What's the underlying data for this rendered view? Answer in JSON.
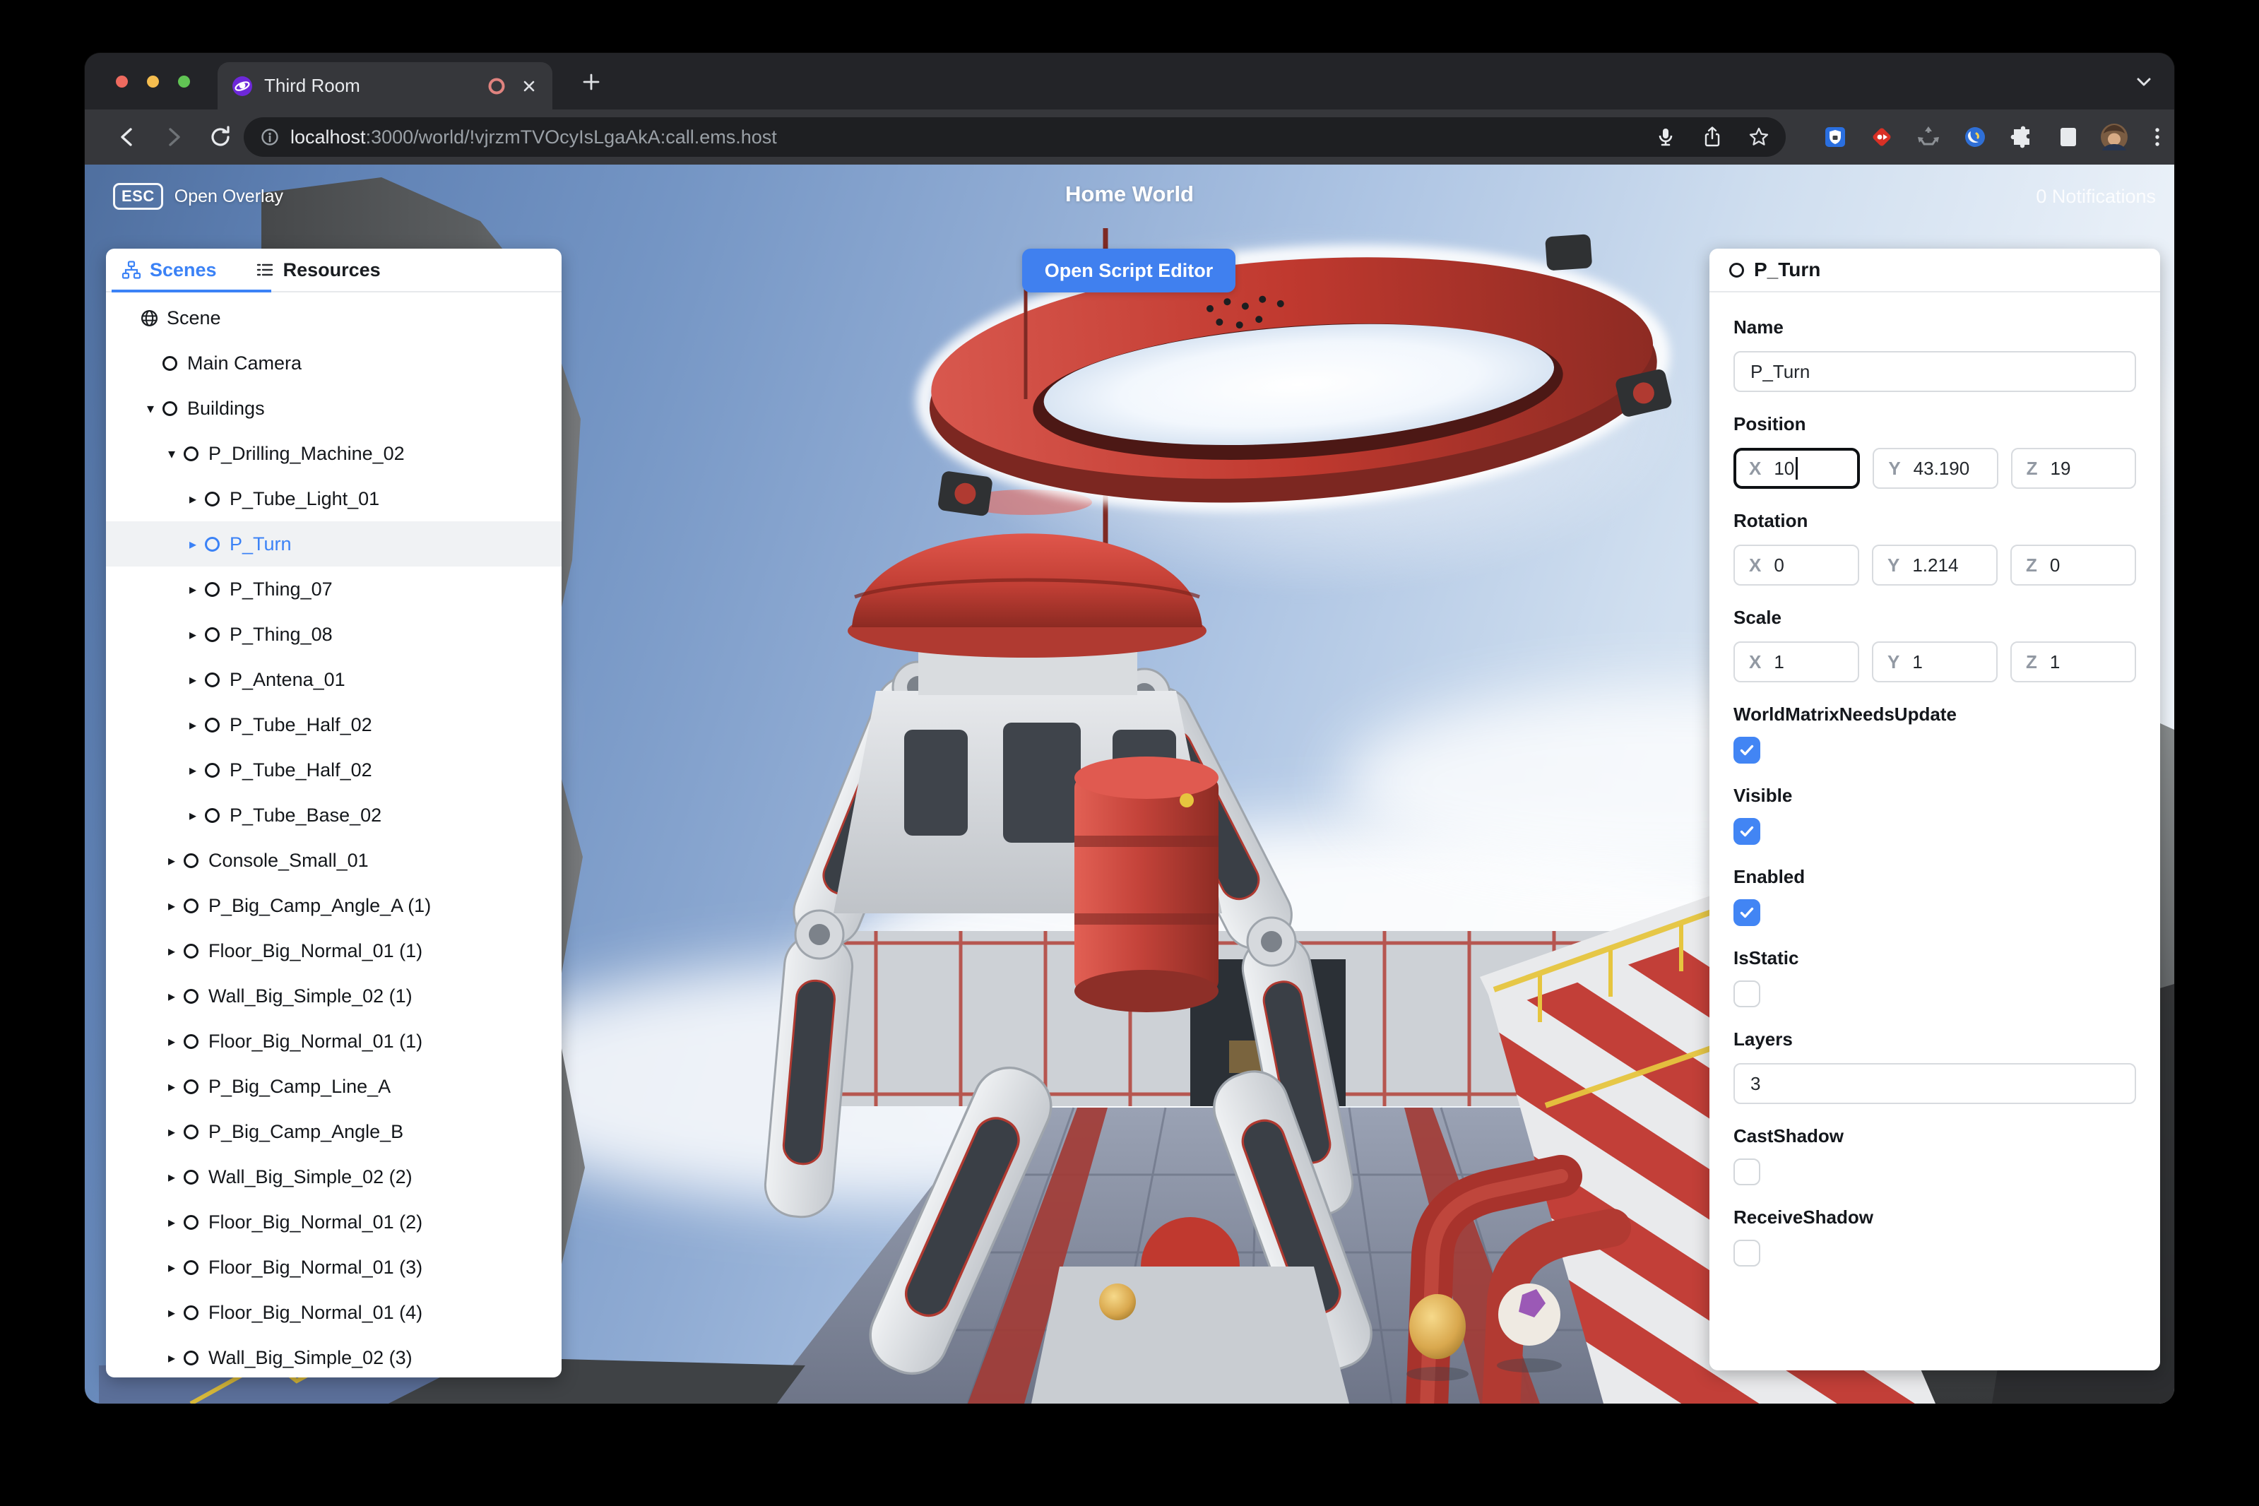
{
  "browser": {
    "tab_title": "Third Room",
    "new_tab": "+",
    "url_host": "localhost",
    "url_path": ":3000/world/!vjrzmTVOcyIsLgaAkA:call.ems.host"
  },
  "hud": {
    "esc_key": "ESC",
    "esc_label": "Open Overlay",
    "title": "Home World",
    "notifications": "0 Notifications",
    "script_editor": "Open Script Editor"
  },
  "left_panel": {
    "tabs": [
      {
        "label": "Scenes",
        "active": true
      },
      {
        "label": "Resources",
        "active": false
      }
    ],
    "tree": [
      {
        "label": "Scene",
        "depth": 0,
        "icon": "globe",
        "caret": "none",
        "selected": false
      },
      {
        "label": "Main Camera",
        "depth": 1,
        "icon": "node",
        "caret": "none",
        "selected": false
      },
      {
        "label": "Buildings",
        "depth": 1,
        "icon": "node",
        "caret": "down",
        "selected": false
      },
      {
        "label": "P_Drilling_Machine_02",
        "depth": 2,
        "icon": "node",
        "caret": "down",
        "selected": false
      },
      {
        "label": "P_Tube_Light_01",
        "depth": 3,
        "icon": "node",
        "caret": "right",
        "selected": false
      },
      {
        "label": "P_Turn",
        "depth": 3,
        "icon": "node",
        "caret": "right",
        "selected": true
      },
      {
        "label": "P_Thing_07",
        "depth": 3,
        "icon": "node",
        "caret": "right",
        "selected": false
      },
      {
        "label": "P_Thing_08",
        "depth": 3,
        "icon": "node",
        "caret": "right",
        "selected": false
      },
      {
        "label": "P_Antena_01",
        "depth": 3,
        "icon": "node",
        "caret": "right",
        "selected": false
      },
      {
        "label": "P_Tube_Half_02",
        "depth": 3,
        "icon": "node",
        "caret": "right",
        "selected": false
      },
      {
        "label": "P_Tube_Half_02",
        "depth": 3,
        "icon": "node",
        "caret": "right",
        "selected": false
      },
      {
        "label": "P_Tube_Base_02",
        "depth": 3,
        "icon": "node",
        "caret": "right",
        "selected": false
      },
      {
        "label": "Console_Small_01",
        "depth": 2,
        "icon": "node",
        "caret": "right",
        "selected": false
      },
      {
        "label": "P_Big_Camp_Angle_A (1)",
        "depth": 2,
        "icon": "node",
        "caret": "right",
        "selected": false
      },
      {
        "label": "Floor_Big_Normal_01 (1)",
        "depth": 2,
        "icon": "node",
        "caret": "right",
        "selected": false
      },
      {
        "label": "Wall_Big_Simple_02 (1)",
        "depth": 2,
        "icon": "node",
        "caret": "right",
        "selected": false
      },
      {
        "label": "Floor_Big_Normal_01 (1)",
        "depth": 2,
        "icon": "node",
        "caret": "right",
        "selected": false
      },
      {
        "label": "P_Big_Camp_Line_A",
        "depth": 2,
        "icon": "node",
        "caret": "right",
        "selected": false
      },
      {
        "label": "P_Big_Camp_Angle_B",
        "depth": 2,
        "icon": "node",
        "caret": "right",
        "selected": false
      },
      {
        "label": "Wall_Big_Simple_02 (2)",
        "depth": 2,
        "icon": "node",
        "caret": "right",
        "selected": false
      },
      {
        "label": "Floor_Big_Normal_01 (2)",
        "depth": 2,
        "icon": "node",
        "caret": "right",
        "selected": false
      },
      {
        "label": "Floor_Big_Normal_01 (3)",
        "depth": 2,
        "icon": "node",
        "caret": "right",
        "selected": false
      },
      {
        "label": "Floor_Big_Normal_01 (4)",
        "depth": 2,
        "icon": "node",
        "caret": "right",
        "selected": false
      },
      {
        "label": "Wall_Big_Simple_02 (3)",
        "depth": 2,
        "icon": "node",
        "caret": "right",
        "selected": false
      }
    ]
  },
  "inspector": {
    "header_title": "P_Turn",
    "axis": {
      "x": "X",
      "y": "Y",
      "z": "Z"
    },
    "name": {
      "label": "Name",
      "value": "P_Turn"
    },
    "position": {
      "label": "Position",
      "x": "10",
      "y": "43.190",
      "z": "19",
      "focused_axis": "x"
    },
    "rotation": {
      "label": "Rotation",
      "x": "0",
      "y": "1.214",
      "z": "0"
    },
    "scale": {
      "label": "Scale",
      "x": "1",
      "y": "1",
      "z": "1"
    },
    "world_matrix": {
      "label": "WorldMatrixNeedsUpdate",
      "checked": true
    },
    "visible": {
      "label": "Visible",
      "checked": true
    },
    "enabled": {
      "label": "Enabled",
      "checked": true
    },
    "is_static": {
      "label": "IsStatic",
      "checked": false
    },
    "layers": {
      "label": "Layers",
      "value": "3"
    },
    "cast_shadow": {
      "label": "CastShadow",
      "checked": false
    },
    "receive_shadow": {
      "label": "ReceiveShadow",
      "checked": false
    }
  },
  "colors": {
    "accent_button": "#4080ef",
    "checkbox_blue": "#4285f4",
    "selection_blue": "#3b82f6",
    "record_indicator": "#e0837f",
    "favicon_purple": "#6d28d9",
    "ring_red": "#c0392f"
  }
}
